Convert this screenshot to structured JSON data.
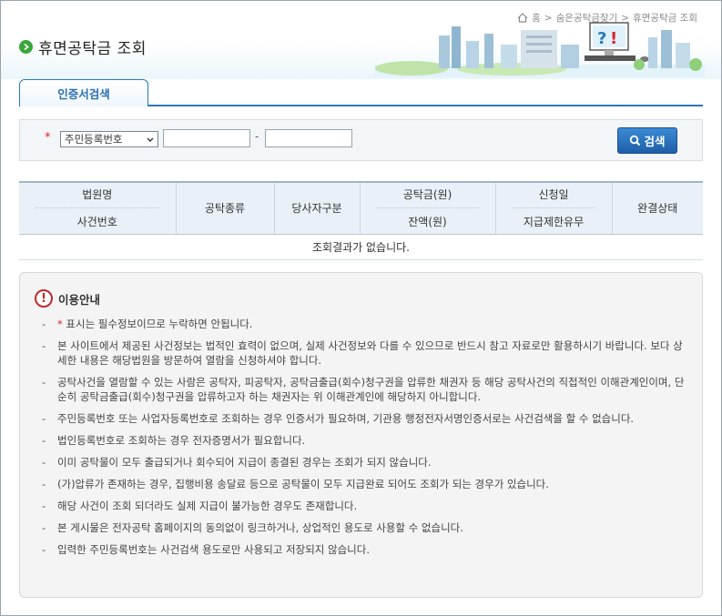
{
  "breadcrumb": {
    "home": "홈",
    "sep": ">",
    "level1": "숨은공탁금찾기",
    "current": "휴면공탁금 조회"
  },
  "page_title": "휴면공탁금 조회",
  "tabs": [
    {
      "label": "인증서검색",
      "active": true
    }
  ],
  "search": {
    "required_mark": "*",
    "id_type_selected": "주민등록번호",
    "id_part1_value": "",
    "id_separator": "-",
    "id_part2_value": "",
    "button_label": "검색"
  },
  "table": {
    "headers": {
      "court": "법원명",
      "case_no": "사건번호",
      "deposit_type": "공탁종류",
      "party_type": "당사자구분",
      "amount": "공탁금(원)",
      "balance": "잔액(원)",
      "request_date": "신청일",
      "payment_limit": "지급제한유무",
      "status": "완결상태"
    },
    "empty_message": "조회결과가 없습니다."
  },
  "notice": {
    "title": "이용안내",
    "star": "*",
    "items": [
      "표시는 필수정보이므로 누락하면 안됩니다.",
      "본 사이트에서 제공된 사건정보는 법적인 효력이 없으며, 실제 사건정보와 다를 수 있으므로 반드시 참고 자료로만 활용하시기 바랍니다. 보다 상세한 내용은 해당법원을 방문하여 열람을 신청하셔야 합니다.",
      "공탁사건을 열람할 수 있는 사람은 공탁자, 피공탁자, 공탁금출급(회수)청구권을 압류한 채권자 등 해당 공탁사건의 직접적인 이해관계인이며, 단순히 공탁금출급(회수)청구권을 압류하고자 하는 채권자는 위 이해관계인에 해당하지 아니합니다.",
      "주민등록번호 또는 사업자등록번호로 조회하는 경우 인증서가 필요하며, 기관용 행정전자서명인증서로는 사건검색을 할 수 없습니다.",
      "법인등록번호로 조회하는 경우 전자증명서가 필요합니다.",
      "이미 공탁물이 모두 출급되거나 회수되어 지급이 종결된 경우는 조회가 되지 않습니다.",
      "(가)압류가 존재하는 경우, 집행비용 송달료 등으로 공탁물이 모두 지급완료 되어도 조회가 되는 경우가 있습니다.",
      "해당 사건이 조회 되더라도 실제 지급이 불가능한 경우도 존재합니다.",
      "본 게시물은 전자공탁 홈페이지의 동의없이 링크하거나, 상업적인 용도로 사용할 수 없습니다.",
      "입력한 주민등록번호는 사건검색 용도로만 사용되고 저장되지 않습니다."
    ]
  },
  "icons": {
    "home": "home-icon",
    "title_bullet": "arrow-circle-icon",
    "search": "magnifier-icon",
    "warning": "exclamation-icon",
    "skyline": "city-skyline-illustration"
  },
  "colors": {
    "accent": "#2a79b9",
    "button": "#1e5fa8",
    "required": "#dd2222",
    "title_bullet": "#3aa63a"
  }
}
